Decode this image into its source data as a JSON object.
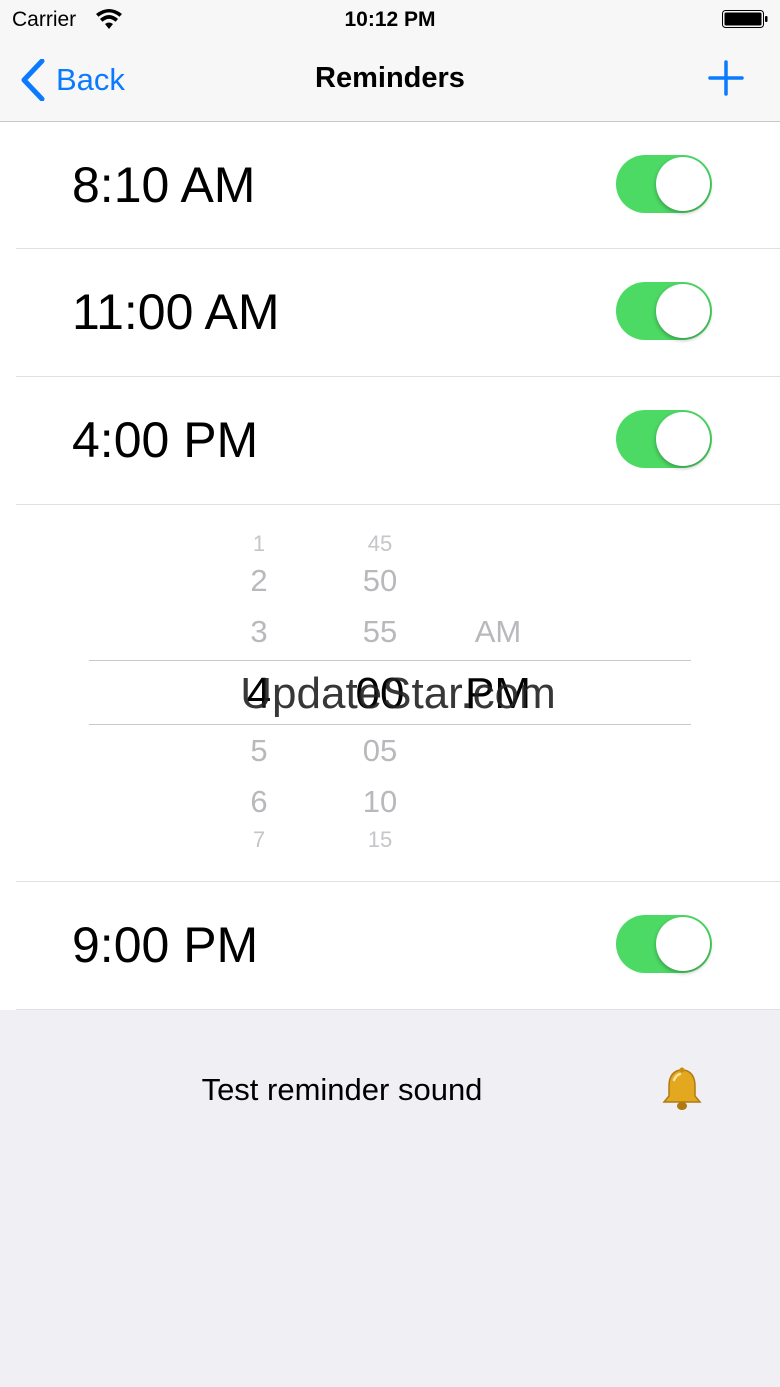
{
  "status_bar": {
    "carrier": "Carrier",
    "time": "10:12 PM"
  },
  "nav": {
    "back_label": "Back",
    "title": "Reminders",
    "add_icon": "plus-icon"
  },
  "reminders": [
    {
      "time": "8:10 AM",
      "enabled": true
    },
    {
      "time": "11:00 AM",
      "enabled": true
    },
    {
      "time": "4:00 PM",
      "enabled": true
    },
    {
      "time": "9:00 PM",
      "enabled": true
    }
  ],
  "picker": {
    "hours": [
      "1",
      "2",
      "3",
      "4",
      "5",
      "6",
      "7"
    ],
    "minutes": [
      "45",
      "50",
      "55",
      "00",
      "05",
      "10",
      "15"
    ],
    "periods": [
      "AM",
      "PM"
    ],
    "selected": {
      "hour": "4",
      "minute": "00",
      "period": "PM"
    }
  },
  "watermark": "UpdateStar.com",
  "test_sound": {
    "label": "Test reminder sound",
    "icon": "bell-icon"
  },
  "colors": {
    "accent": "#0a7aff",
    "toggle_on": "#4cd964",
    "background": "#efeff4"
  }
}
